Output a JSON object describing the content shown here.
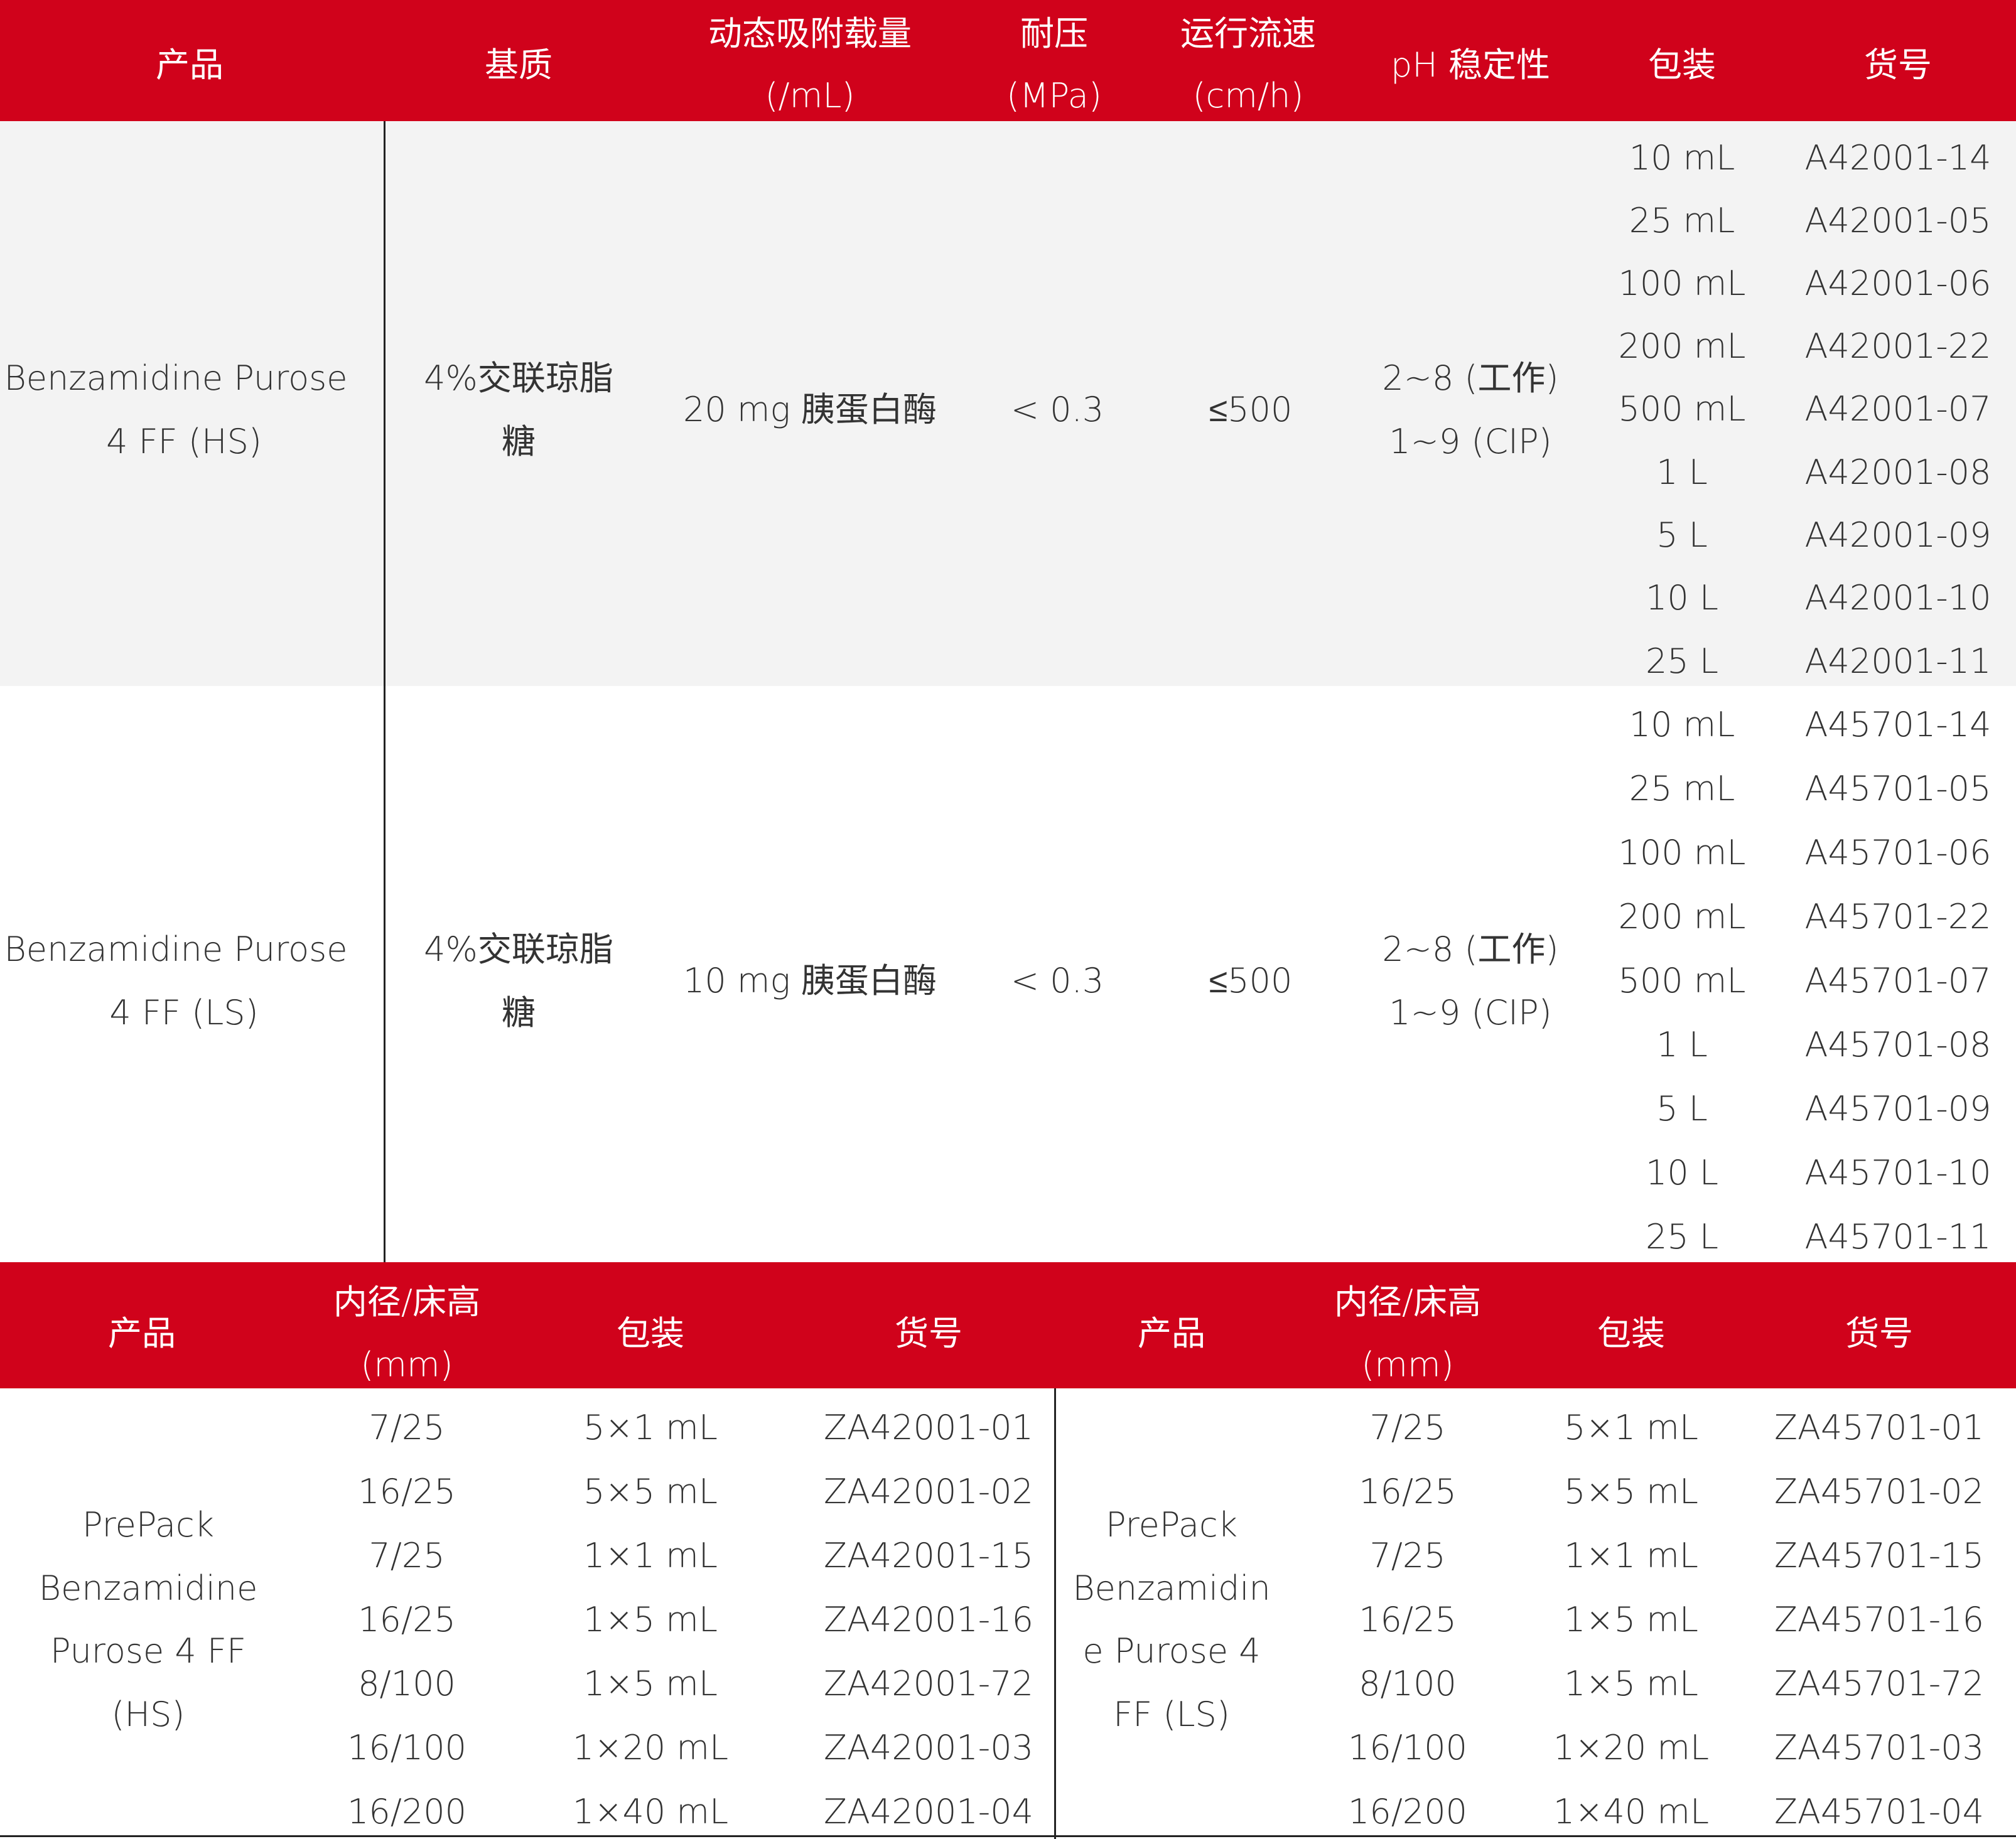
{
  "table1": {
    "headers": {
      "product": "产品",
      "matrix": "基质",
      "capacity": [
        "动态吸附载量",
        "(/mL)"
      ],
      "pressure": [
        "耐压",
        "(MPa)"
      ],
      "flow": [
        "运行流速",
        "(cm/h)"
      ],
      "ph": "pH 稳定性",
      "pack": "包装",
      "catalog": "货号"
    },
    "rows": [
      {
        "product": [
          "Benzamidine Purose",
          "4 FF (HS)"
        ],
        "matrix": [
          "4%交联琼脂",
          "糖"
        ],
        "capacity": "20 mg 胰蛋白酶",
        "pressure": "< 0.3",
        "flow": "≤500",
        "ph": [
          "2~8 (工作)",
          "1~9 (CIP)"
        ],
        "packs": [
          "10 mL",
          "25 mL",
          "100 mL",
          "200 mL",
          "500 mL",
          "1 L",
          "5 L",
          "10 L",
          "25 L"
        ],
        "catalogs": [
          "A42001-14",
          "A42001-05",
          "A42001-06",
          "A42001-22",
          "A42001-07",
          "A42001-08",
          "A42001-09",
          "A42001-10",
          "A42001-11"
        ]
      },
      {
        "product": [
          "Benzamidine Purose",
          "4 FF (LS)"
        ],
        "matrix": [
          "4%交联琼脂",
          "糖"
        ],
        "capacity": "10 mg 胰蛋白酶",
        "pressure": "< 0.3",
        "flow": "≤500",
        "ph": [
          "2~8 (工作)",
          "1~9 (CIP)"
        ],
        "packs": [
          "10 mL",
          "25 mL",
          "100 mL",
          "200 mL",
          "500 mL",
          "1 L",
          "5 L",
          "10 L",
          "25 L"
        ],
        "catalogs": [
          "A45701-14",
          "A45701-05",
          "A45701-06",
          "A45701-22",
          "A45701-07",
          "A45701-08",
          "A45701-09",
          "A45701-10",
          "A45701-11"
        ]
      }
    ]
  },
  "table2": {
    "headers": {
      "product": "产品",
      "size": [
        "内径/床高",
        "(mm)"
      ],
      "pack": "包装",
      "catalog": "货号"
    },
    "left": {
      "product": [
        "PrePack",
        "Benzamidine",
        "Purose 4 FF",
        "(HS)"
      ],
      "sizes": [
        "7/25",
        "16/25",
        "7/25",
        "16/25",
        "8/100",
        "16/100",
        "16/200"
      ],
      "packs": [
        "5×1 mL",
        "5×5 mL",
        "1×1 mL",
        "1×5 mL",
        "1×5 mL",
        "1×20 mL",
        "1×40 mL"
      ],
      "catalogs": [
        "ZA42001-01",
        "ZA42001-02",
        "ZA42001-15",
        "ZA42001-16",
        "ZA42001-72",
        "ZA42001-03",
        "ZA42001-04"
      ]
    },
    "right": {
      "product": [
        "PrePack",
        "Benzamidin",
        "e Purose 4",
        "FF (LS)"
      ],
      "sizes": [
        "7/25",
        "16/25",
        "7/25",
        "16/25",
        "8/100",
        "16/100",
        "16/200"
      ],
      "packs": [
        "5×1 mL",
        "5×5 mL",
        "1×1 mL",
        "1×5 mL",
        "1×5 mL",
        "1×20 mL",
        "1×40 mL"
      ],
      "catalogs": [
        "ZA45701-01",
        "ZA45701-02",
        "ZA45701-15",
        "ZA45701-16",
        "ZA45701-72",
        "ZA45701-03",
        "ZA45701-04"
      ]
    }
  },
  "colors": {
    "header_bg": "#d0021b",
    "header_text": "#ffffff",
    "band_gray": "#f3f3f3",
    "text": "#333333"
  }
}
